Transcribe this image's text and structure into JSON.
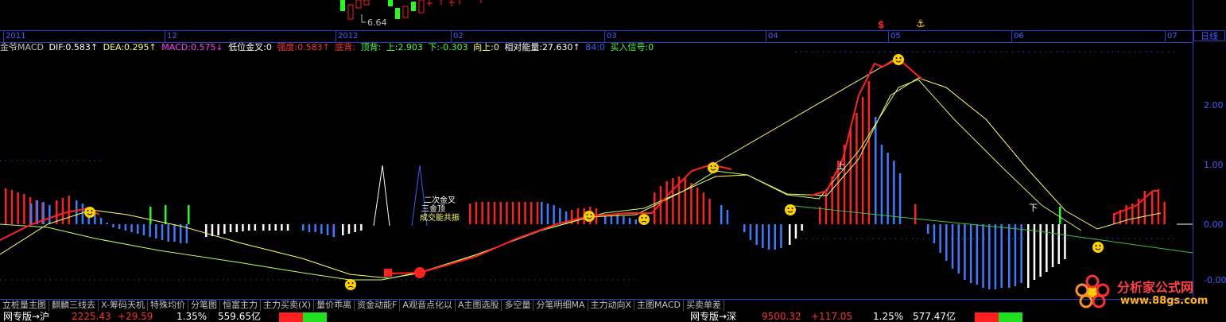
{
  "top_price_label": "6.64",
  "marker_s": "$",
  "marker_anchor": "⚓",
  "timebar": {
    "labels": [
      "2011",
      "12",
      "2012",
      "02",
      "03",
      "04",
      "05",
      "06",
      "07"
    ],
    "period": "日线"
  },
  "indicator": {
    "name": "金爷MACD",
    "dif": "DIF:0.583↑",
    "dea": "DEA:0.295↑",
    "macd": "MACD:0.575↓",
    "low_cross": "低位金叉:0",
    "strength": "强度:0.583↑",
    "bottom_div": "底背:",
    "top_div": "顶背:",
    "up": "上:2.903",
    "down": "下:-0.303",
    "up_dir": "向上:0",
    "rel_energy": "相对能量:27.630↑",
    "val84": "84:0",
    "buy_signal": "买入信号:0"
  },
  "y_axis": [
    "2.00",
    "1.00",
    "0.00",
    "-0.00"
  ],
  "annotations": {
    "second_cross": "二次金叉",
    "third_top": "三金顶",
    "resonance": "成交能共振",
    "up": "上",
    "down": "下"
  },
  "tabs": [
    "立桩量主图",
    "麒麟三线去",
    "X-筹码天机",
    "特殊均价",
    "分笔图",
    "恒富主力",
    "主力买卖(X)",
    "量价乖离",
    "资金动能F",
    "A观音点化以",
    "A主图选股",
    "多空量",
    "分笔明细MA",
    "主力动向X",
    "主图MACD",
    "买卖单差"
  ],
  "status": {
    "left_name": "网专版→沪",
    "left_index": "2225.43",
    "left_change": "+29.59",
    "left_pct": "1.35%",
    "left_amount": "559.65亿",
    "right_name": "网专版→深",
    "right_index": "9500.32",
    "right_change": "+117.05",
    "right_pct": "1.25%",
    "right_amount": "577.47亿"
  },
  "logo": {
    "title": "分析家公式网",
    "url": "www.88gs.com"
  },
  "colors": {
    "axis_blue": "#2a3fbf",
    "red": "#ff2020",
    "green": "#20ff20",
    "blue_bar": "#3a7cff",
    "yellow": "#ffff60"
  }
}
